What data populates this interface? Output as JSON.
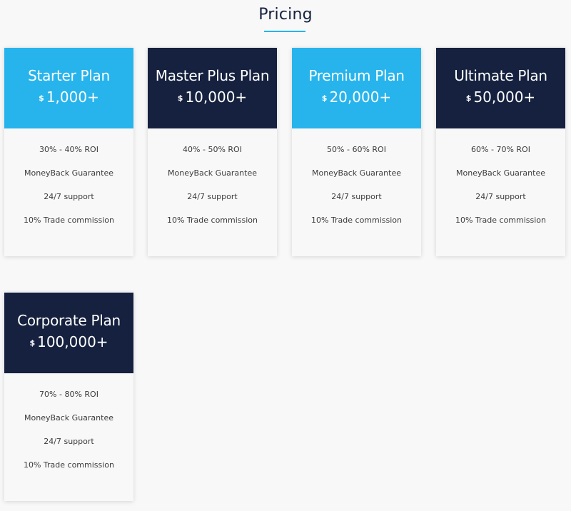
{
  "section": {
    "title": "Pricing"
  },
  "colors": {
    "accent_light": "#27b4ec",
    "accent_dark": "#15213f",
    "background": "#f8f8f8"
  },
  "plans": [
    {
      "name": "Starter Plan",
      "currency": "$",
      "price": "1,000+",
      "theme": "light",
      "features": [
        "30% - 40% ROI",
        "MoneyBack Guarantee",
        "24/7 support",
        "10% Trade commission"
      ]
    },
    {
      "name": "Master Plus Plan",
      "currency": "$",
      "price": "10,000+",
      "theme": "dark",
      "features": [
        "40% - 50% ROI",
        "MoneyBack Guarantee",
        "24/7 support",
        "10% Trade commission"
      ]
    },
    {
      "name": "Premium Plan",
      "currency": "$",
      "price": "20,000+",
      "theme": "light",
      "features": [
        "50% - 60% ROI",
        "MoneyBack Guarantee",
        "24/7 support",
        "10% Trade commission"
      ]
    },
    {
      "name": "Ultimate Plan",
      "currency": "$",
      "price": "50,000+",
      "theme": "dark",
      "features": [
        "60% - 70% ROI",
        "MoneyBack Guarantee",
        "24/7 support",
        "10% Trade commission"
      ]
    },
    {
      "name": "Corporate Plan",
      "currency": "$",
      "price": "100,000+",
      "theme": "dark",
      "features": [
        "70% - 80% ROI",
        "MoneyBack Guarantee",
        "24/7 support",
        "10% Trade commission"
      ]
    }
  ]
}
